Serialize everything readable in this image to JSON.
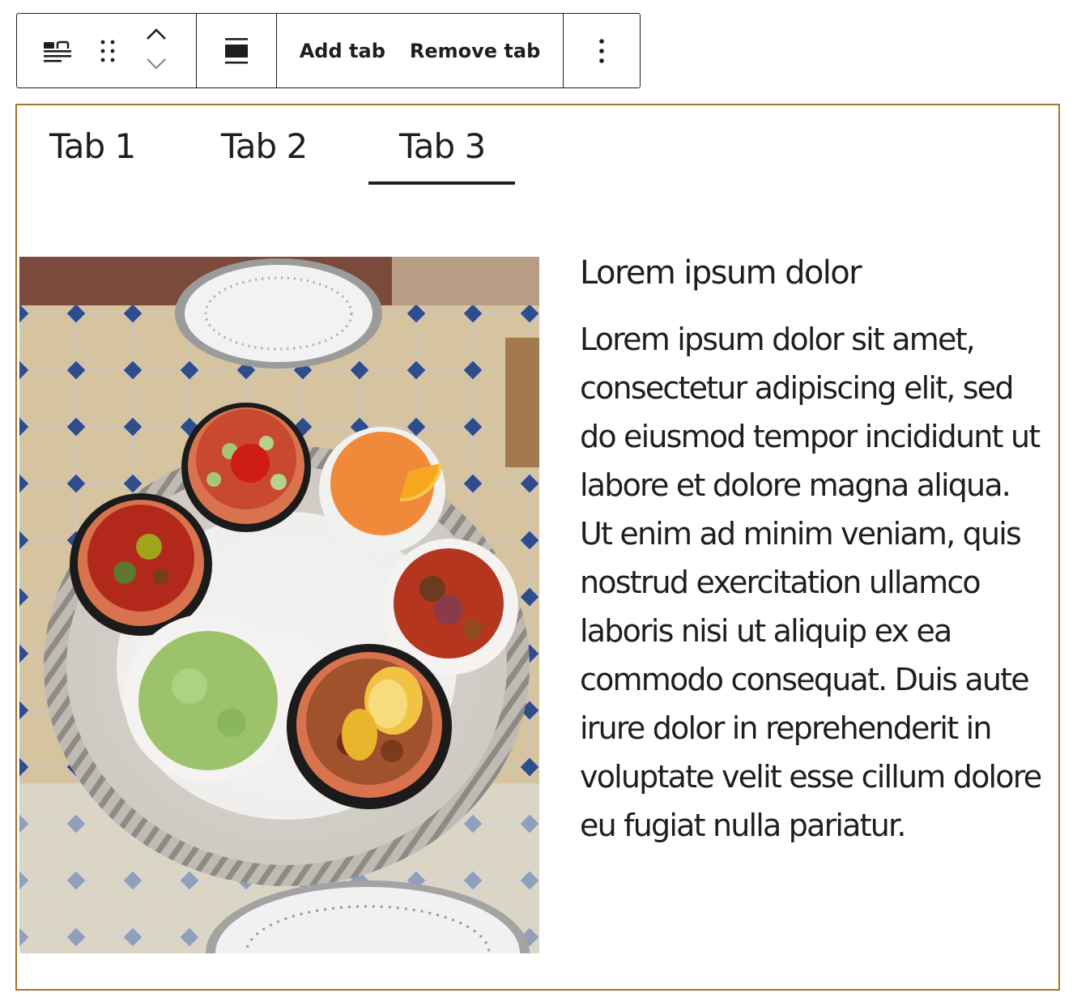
{
  "toolbar": {
    "tabs_icon": "tabs-block-icon",
    "drag_icon": "drag-handle-icon",
    "move_up_icon": "chevron-up-icon",
    "move_down_icon": "chevron-down-icon",
    "align_icon": "align-full-width-icon",
    "add_tab_label": "Add tab",
    "remove_tab_label": "Remove tab",
    "more_icon": "more-vertical-icon"
  },
  "tabs": [
    {
      "label": "Tab 1",
      "active": false
    },
    {
      "label": "Tab 2",
      "active": false
    },
    {
      "label": "Tab 3",
      "active": true
    }
  ],
  "panel": {
    "image_subject": "Moroccan salads in bowls on a silver tray",
    "heading": "Lorem ipsum dolor",
    "paragraph": "Lorem ipsum dolor sit amet, consectetur adipiscing elit, sed do eiusmod tempor incididunt ut labore et dolore magna aliqua. Ut enim ad minim veniam, quis nostrud exercitation ullamco laboris nisi ut aliquip ex ea commodo consequat. Duis aute irure dolor in reprehenderit in voluptate velit esse cillum dolore eu fugiat nulla pariatur."
  },
  "colors": {
    "block_border": "#a8732f",
    "text": "#1e1e1e",
    "toolbar_border": "#1e1e1e"
  }
}
